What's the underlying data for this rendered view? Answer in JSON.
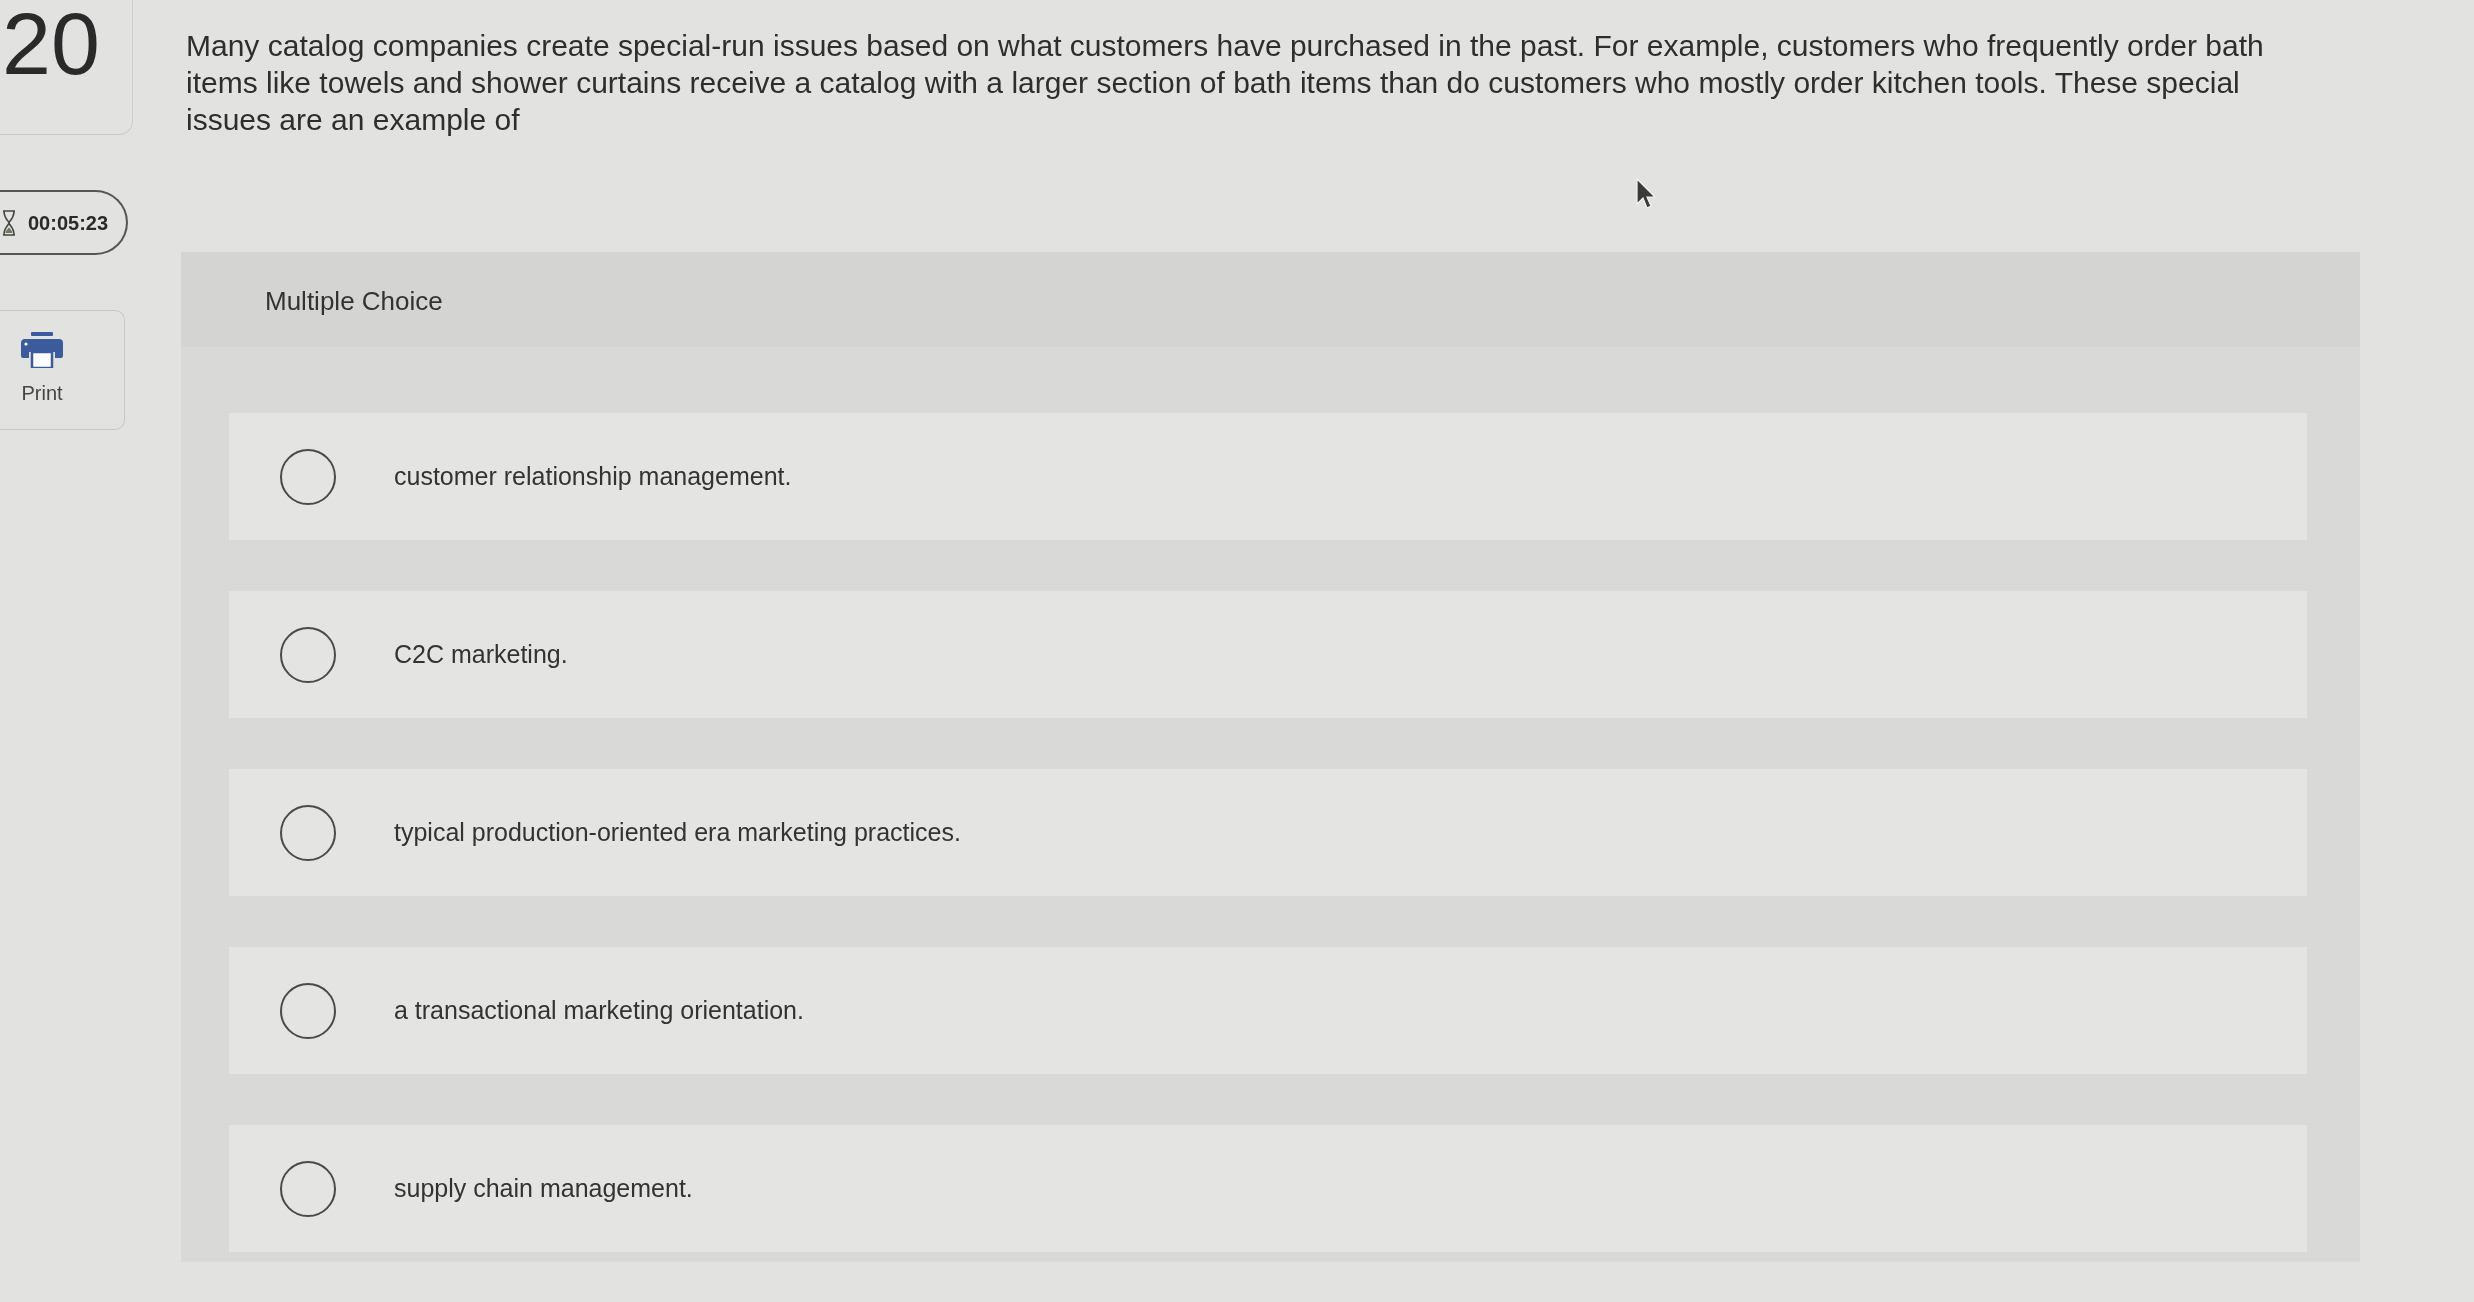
{
  "question": {
    "number": "20",
    "text": "Many catalog companies create special-run issues based on what customers have purchased in the past. For example, customers who frequently order bath items like towels and shower curtains receive a catalog with a larger section of bath items than do customers who mostly order kitchen tools. These special issues are an example of"
  },
  "timer": {
    "time": "00:05:23"
  },
  "print_button": {
    "label": "Print"
  },
  "answer_panel": {
    "type_label": "Multiple Choice",
    "options": [
      {
        "label": "customer relationship management.",
        "selected": false
      },
      {
        "label": "C2C marketing.",
        "selected": false
      },
      {
        "label": "typical production-oriented era marketing practices.",
        "selected": false
      },
      {
        "label": "a transactional marketing orientation.",
        "selected": false
      },
      {
        "label": "supply chain management.",
        "selected": false
      }
    ]
  }
}
